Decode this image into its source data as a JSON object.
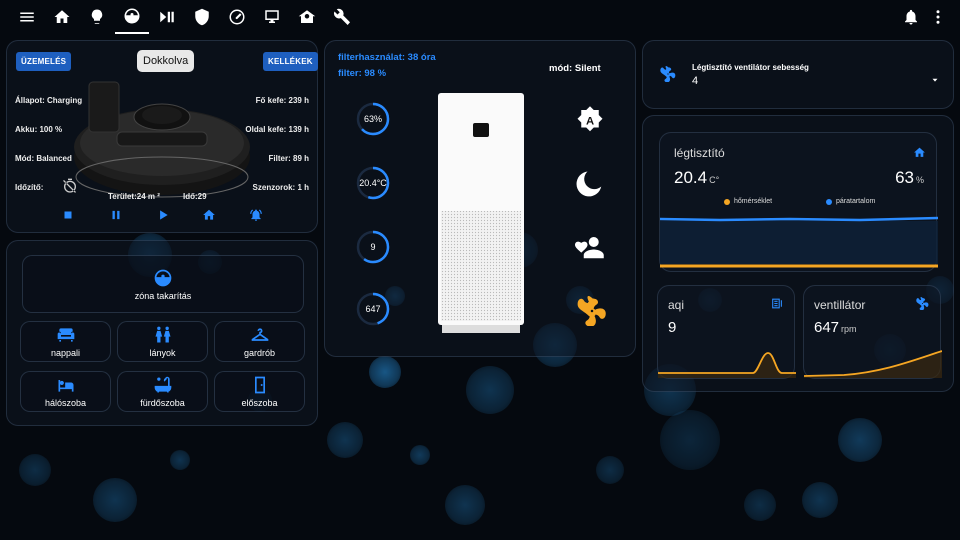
{
  "nav": {
    "icons": [
      "menu-icon",
      "home-icon",
      "lightbulb-icon",
      "robot-vacuum-icon",
      "play-pause-icon",
      "shield-home-icon",
      "gauge-icon",
      "monitor-icon",
      "house-icon",
      "wrench-icon"
    ],
    "active_index": 3,
    "right_icons": [
      "bell-icon",
      "more-vert-icon"
    ]
  },
  "vacuum": {
    "btn_operation": "ÜZEMELÉS",
    "btn_supplies": "KELLÉKEK",
    "status_chip": "Dokkolva",
    "state": "Állapot: Charging",
    "battery": "Akku: 100 %",
    "mode": "Mód: Balanced",
    "timer_label": "Időzítő:",
    "main_brush": "Fő kefe: 239 h",
    "side_brush": "Oldal kefe: 139 h",
    "filter": "Filter: 89 h",
    "sensors": "Szenzorok: 1 h",
    "area": "Terület:24 m ²",
    "time": "Idő:29"
  },
  "zones": {
    "zone_clean": "zóna takarítás",
    "rooms": [
      "nappali",
      "lányok",
      "gardrób",
      "hálószoba",
      "fürdőszoba",
      "előszoba"
    ]
  },
  "purifier": {
    "filter_usage": "filterhasználat: 38 óra",
    "filter_pct": "filter: 98 %",
    "mode": "mód: Silent",
    "humidity": "63%",
    "temperature": "20.4°C",
    "level": "9",
    "rpm": "647",
    "humidity_fraction": 0.63,
    "temperature_fraction": 0.55,
    "level_fraction": 0.6,
    "rpm_fraction": 0.45
  },
  "fan_speed": {
    "label": "Légtisztító ventilátor sebesség",
    "value": "4"
  },
  "air_card": {
    "title": "légtisztító",
    "temp": "20.4",
    "temp_unit": "C°",
    "humidity": "63",
    "humidity_unit": "%",
    "legend_temp": "hőmérséklet",
    "legend_hum": "páratartalom"
  },
  "aqi_card": {
    "title": "aqi",
    "value": "9"
  },
  "fan_card": {
    "title": "ventillátor",
    "value": "647",
    "unit": "rpm"
  },
  "colors": {
    "accent": "#2a8bff",
    "orange": "#f5a623",
    "active_fan": "#f5a623"
  }
}
